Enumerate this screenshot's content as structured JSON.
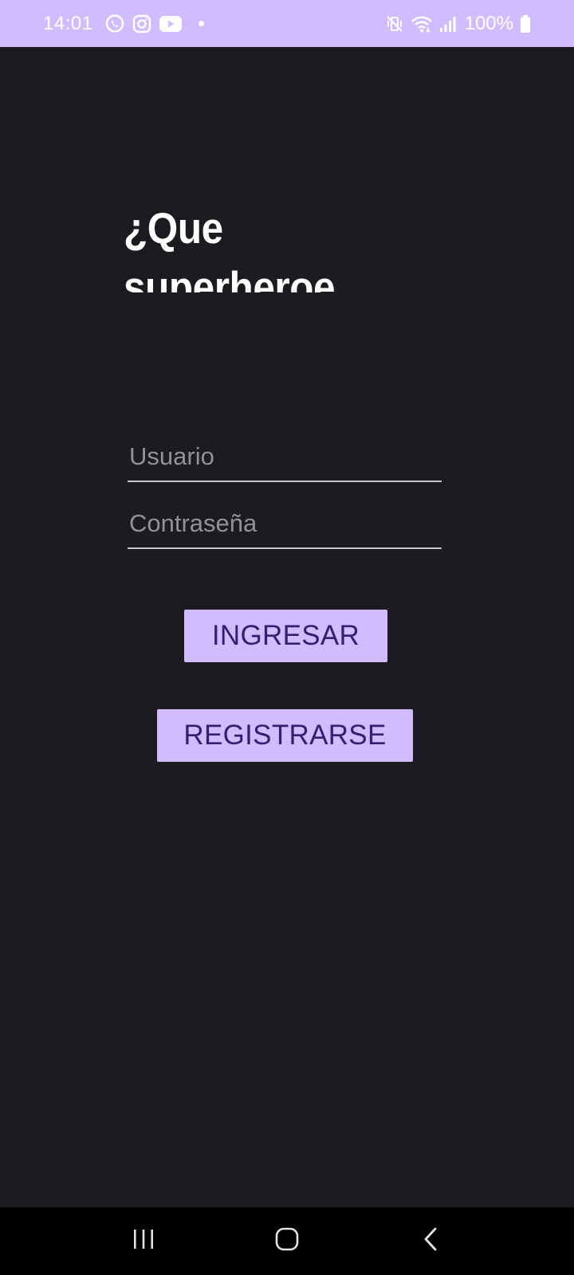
{
  "status_bar": {
    "time": "14:01",
    "battery_percent": "100%",
    "background": "#d0bcfe",
    "notification_icons": [
      "whatsapp-icon",
      "instagram-icon",
      "youtube-icon"
    ],
    "system_icons": [
      "vibrate-off-icon",
      "wifi-icon",
      "signal-icon",
      "battery-icon"
    ]
  },
  "main": {
    "headline": "¿Que superheroe",
    "username_field": {
      "value": "",
      "placeholder": "Usuario"
    },
    "password_field": {
      "value": "",
      "placeholder": "Contraseña"
    },
    "login_button_label": "INGRESAR",
    "register_button_label": "REGISTRARSE"
  },
  "nav_bar": {
    "icons": [
      "recent-apps-icon",
      "home-icon",
      "back-icon"
    ]
  },
  "colors": {
    "background": "#1c1b20",
    "accent": "#d0bcfe",
    "button_text": "#381e72",
    "field_underline": "#cac4d0",
    "placeholder": "#958f9b"
  }
}
